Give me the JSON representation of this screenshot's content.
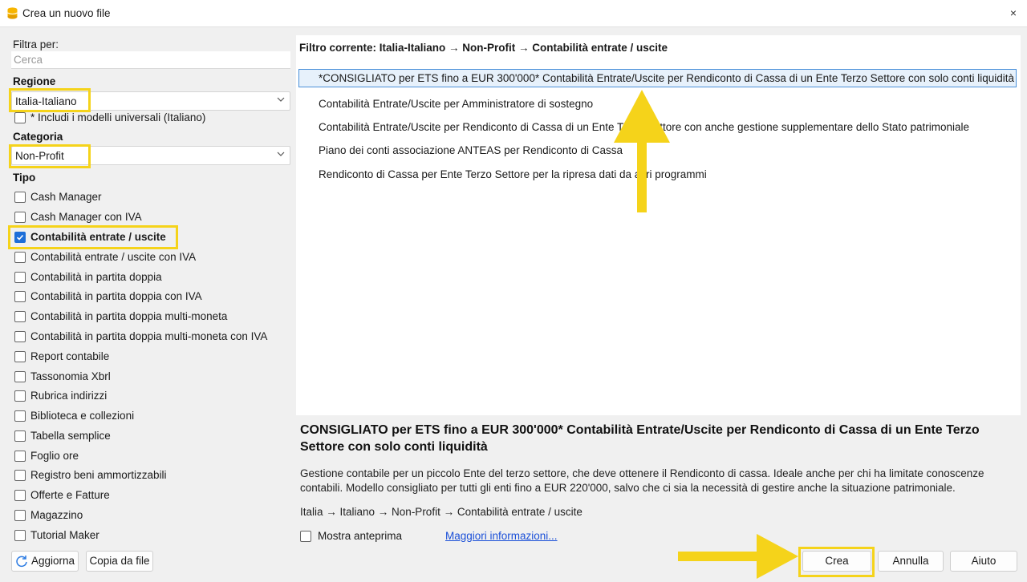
{
  "window": {
    "title": "Crea un nuovo file",
    "close_label": "×"
  },
  "filter": {
    "label": "Filtra per:",
    "search_placeholder": "Cerca",
    "region_label": "Regione",
    "region_value": "Italia-Italiano",
    "include_universal_label": "* Includi i modelli universali (Italiano)",
    "category_label": "Categoria",
    "category_value": "Non-Profit",
    "type_label": "Tipo"
  },
  "types": [
    {
      "label": "Cash Manager",
      "checked": false
    },
    {
      "label": "Cash Manager con IVA",
      "checked": false
    },
    {
      "label": "Contabilità entrate / uscite",
      "checked": true
    },
    {
      "label": "Contabilità entrate / uscite con IVA",
      "checked": false
    },
    {
      "label": "Contabilità in partita doppia",
      "checked": false
    },
    {
      "label": "Contabilità in partita doppia con IVA",
      "checked": false
    },
    {
      "label": "Contabilità in partita doppia multi-moneta",
      "checked": false
    },
    {
      "label": "Contabilità in partita doppia multi-moneta con IVA",
      "checked": false
    },
    {
      "label": "Report contabile",
      "checked": false
    },
    {
      "label": "Tassonomia Xbrl",
      "checked": false
    },
    {
      "label": "Rubrica indirizzi",
      "checked": false
    },
    {
      "label": "Biblioteca e collezioni",
      "checked": false
    },
    {
      "label": "Tabella semplice",
      "checked": false
    },
    {
      "label": "Foglio ore",
      "checked": false
    },
    {
      "label": "Registro beni ammortizzabili",
      "checked": false
    },
    {
      "label": "Offerte e Fatture",
      "checked": false
    },
    {
      "label": "Magazzino",
      "checked": false
    },
    {
      "label": "Tutorial Maker",
      "checked": false
    }
  ],
  "left_buttons": {
    "refresh": "Aggiorna",
    "copy": "Copia da file"
  },
  "templates": {
    "current_filter": "Filtro corrente: Italia-Italiano → Non-Profit → Contabilità entrate / uscite",
    "items": [
      "*CONSIGLIATO per ETS fino a EUR 300'000* Contabilità Entrate/Uscite per Rendiconto di Cassa di un Ente Terzo Settore con solo conti liquidità",
      "Contabilità Entrate/Uscite per Amministratore di sostegno",
      "Contabilità Entrate/Uscite per Rendiconto di Cassa di un Ente Terzo Settore con anche gestione supplementare dello Stato patrimoniale",
      "Piano dei conti associazione ANTEAS per Rendiconto di Cassa",
      "Rendiconto di Cassa per Ente Terzo Settore per la ripresa dati da altri programmi"
    ]
  },
  "description": {
    "title": "CONSIGLIATO per ETS fino a EUR 300'000* Contabilità Entrate/Uscite per Rendiconto di Cassa di un Ente Terzo Settore con solo conti liquidità",
    "body": "Gestione contabile per un piccolo Ente del terzo settore, che deve ottenere il Rendiconto di cassa. Ideale anche per chi ha limitate conoscenze contabili. Modello consigliato per tutti gli enti fino a EUR 220'000, salvo che ci sia la necessità di gestire anche la situazione patrimoniale.",
    "path": "Italia → Italiano → Non-Profit → Contabilità entrate / uscite",
    "preview_label": "Mostra anteprima",
    "more_info_link": "Maggiori informazioni..."
  },
  "actions": {
    "create": "Crea",
    "cancel": "Annulla",
    "help": "Aiuto"
  },
  "colors": {
    "highlight": "#f5d31a",
    "selection_border": "#4a90d9",
    "selection_bg": "#e7f1fb",
    "link": "#1a4fd8",
    "check_blue": "#1d6ed8"
  }
}
